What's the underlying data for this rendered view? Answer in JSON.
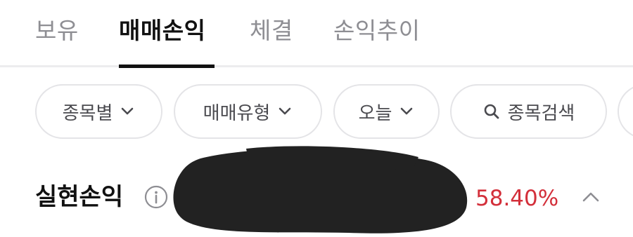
{
  "tabs": [
    {
      "label": "보유"
    },
    {
      "label": "매매손익"
    },
    {
      "label": "체결"
    },
    {
      "label": "손익추이"
    }
  ],
  "active_tab_index": 1,
  "filters": {
    "by_stock": "종목별",
    "trade_type": "매매유형",
    "period": "오늘",
    "search": "종목검색"
  },
  "realized_pl": {
    "label": "실현손익",
    "rate": "58.40%"
  },
  "colors": {
    "active_text": "#111111",
    "inactive_text": "#8e8e93",
    "profit_red": "#d32f3a",
    "chip_border": "#e4e4e7"
  },
  "icons": {
    "chevron": "chevron-down-icon",
    "search": "search-icon",
    "info": "info-icon",
    "collapse": "chevron-up-icon"
  }
}
